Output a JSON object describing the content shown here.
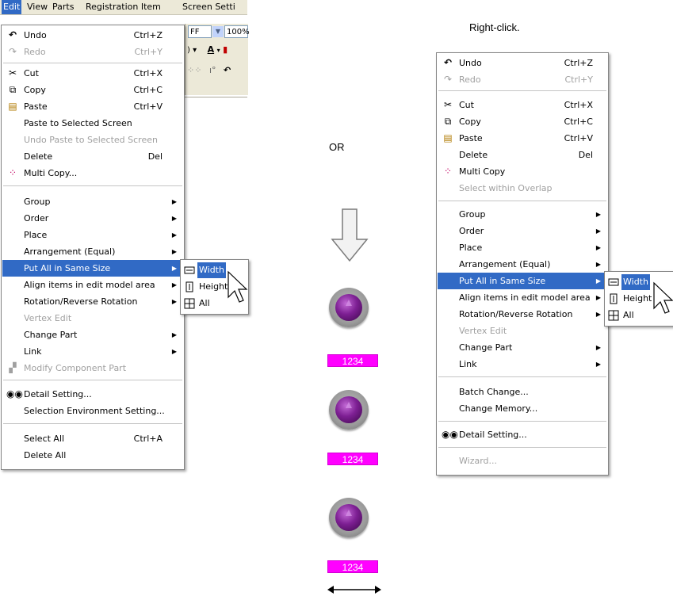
{
  "menubar": {
    "items": [
      "Edit",
      "View",
      "Parts",
      "Registration Item",
      "Screen Setti"
    ]
  },
  "toolbar": {
    "combo1_value": "FF",
    "zoom_value": "100%"
  },
  "left_menu": {
    "items": [
      {
        "label": "Undo",
        "shortcut": "Ctrl+Z",
        "icon": "undo-icon"
      },
      {
        "label": "Redo",
        "shortcut": "Ctrl+Y",
        "icon": "redo-icon"
      },
      {
        "label": "Cut",
        "shortcut": "Ctrl+X",
        "icon": "scissors-icon"
      },
      {
        "label": "Copy",
        "shortcut": "Ctrl+C",
        "icon": "copy-icon"
      },
      {
        "label": "Paste",
        "shortcut": "Ctrl+V",
        "icon": "paste-icon"
      },
      {
        "label": "Paste to Selected Screen"
      },
      {
        "label": "Undo Paste to Selected Screen"
      },
      {
        "label": "Delete",
        "shortcut": "Del"
      },
      {
        "label": "Multi Copy...",
        "icon": "multi-copy-icon"
      },
      {
        "label": "Group"
      },
      {
        "label": "Order"
      },
      {
        "label": "Place"
      },
      {
        "label": "Arrangement (Equal)"
      },
      {
        "label": "Put All in Same Size"
      },
      {
        "label": "Align items in edit model area"
      },
      {
        "label": "Rotation/Reverse Rotation"
      },
      {
        "label": "Vertex Edit"
      },
      {
        "label": "Change Part"
      },
      {
        "label": "Link"
      },
      {
        "label": "Modify Component Part",
        "icon": "component-icon"
      },
      {
        "label": "Detail Setting...",
        "icon": "glasses-icon"
      },
      {
        "label": "Selection Environment Setting..."
      },
      {
        "label": "Select All",
        "shortcut": "Ctrl+A"
      },
      {
        "label": "Delete All"
      }
    ]
  },
  "left_submenu": {
    "items": [
      {
        "label": "Width",
        "icon": "width-icon"
      },
      {
        "label": "Height",
        "icon": "height-icon"
      },
      {
        "label": "All",
        "icon": "all-icon"
      }
    ]
  },
  "middle": {
    "or_label": "OR",
    "lamps": [
      {
        "value": "1234"
      },
      {
        "value": "1234"
      },
      {
        "value": "1234"
      }
    ],
    "colors": {
      "number_box": "#ff00ff",
      "lamp": "#7d1f93"
    }
  },
  "right": {
    "caption": "Right-click."
  },
  "right_menu": {
    "items": [
      {
        "label": "Undo",
        "shortcut": "Ctrl+Z",
        "icon": "undo-icon"
      },
      {
        "label": "Redo",
        "shortcut": "Ctrl+Y",
        "icon": "redo-icon"
      },
      {
        "label": "Cut",
        "shortcut": "Ctrl+X",
        "icon": "scissors-icon"
      },
      {
        "label": "Copy",
        "shortcut": "Ctrl+C",
        "icon": "copy-icon"
      },
      {
        "label": "Paste",
        "shortcut": "Ctrl+V",
        "icon": "paste-icon"
      },
      {
        "label": "Delete",
        "shortcut": "Del"
      },
      {
        "label": "Multi Copy",
        "icon": "multi-copy-icon"
      },
      {
        "label": "Select within Overlap"
      },
      {
        "label": "Group"
      },
      {
        "label": "Order"
      },
      {
        "label": "Place"
      },
      {
        "label": "Arrangement (Equal)"
      },
      {
        "label": "Put All in Same Size"
      },
      {
        "label": "Align items in edit model area"
      },
      {
        "label": "Rotation/Reverse Rotation"
      },
      {
        "label": "Vertex Edit"
      },
      {
        "label": "Change Part"
      },
      {
        "label": "Link"
      },
      {
        "label": "Batch Change..."
      },
      {
        "label": "Change Memory..."
      },
      {
        "label": "Detail Setting...",
        "icon": "glasses-icon"
      },
      {
        "label": "Wizard..."
      }
    ]
  },
  "right_submenu": {
    "items": [
      {
        "label": "Width",
        "icon": "width-icon"
      },
      {
        "label": "Height",
        "icon": "height-icon"
      },
      {
        "label": "All",
        "icon": "all-icon"
      }
    ]
  }
}
